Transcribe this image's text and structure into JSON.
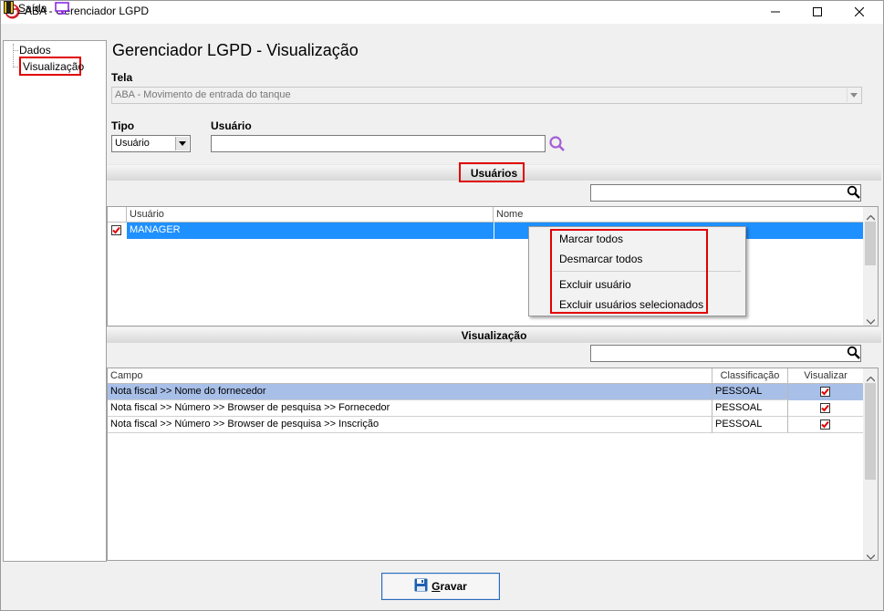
{
  "window": {
    "title": "ABA - Gerenciador LGPD"
  },
  "menu": {
    "exit_first_letter": "S",
    "exit_rest": "aída"
  },
  "tree": {
    "items": [
      {
        "label": "Dados"
      },
      {
        "label": "Visualização"
      }
    ]
  },
  "main": {
    "title": "Gerenciador LGPD - Visualização",
    "tela_label": "Tela",
    "tela_value": "ABA - Movimento de entrada do tanque",
    "tipo_label": "Tipo",
    "tipo_value": "Usuário",
    "usuario_label": "Usuário",
    "usuario_value": ""
  },
  "users_section": {
    "header": "Usuários",
    "filter_value": "",
    "columns": [
      "Usuário",
      "Nome"
    ],
    "rows": [
      {
        "checked": true,
        "usuario": "MANAGER",
        "nome": ""
      }
    ]
  },
  "context_menu": {
    "items": [
      "Marcar todos",
      "Desmarcar todos",
      "Excluir usuário",
      "Excluir usuários selecionados"
    ]
  },
  "vis_section": {
    "header": "Visualização",
    "filter_value": "",
    "columns": [
      "Campo",
      "Classificação",
      "Visualizar"
    ],
    "rows": [
      {
        "campo": "Nota fiscal >> Nome do fornecedor",
        "classificacao": "PESSOAL",
        "visualizar": true
      },
      {
        "campo": "Nota fiscal >> Número >> Browser de pesquisa >> Fornecedor",
        "classificacao": "PESSOAL",
        "visualizar": true
      },
      {
        "campo": "Nota fiscal >> Número >> Browser de pesquisa >> Inscrição",
        "classificacao": "PESSOAL",
        "visualizar": true
      }
    ]
  },
  "footer": {
    "save_first_letter": "G",
    "save_rest": "ravar"
  },
  "colors": {
    "highlight_red": "#e00000",
    "selected_row_users": "#1e90ff",
    "selected_row_vis": "#a8bfe8",
    "logo_red": "#d0202a"
  }
}
